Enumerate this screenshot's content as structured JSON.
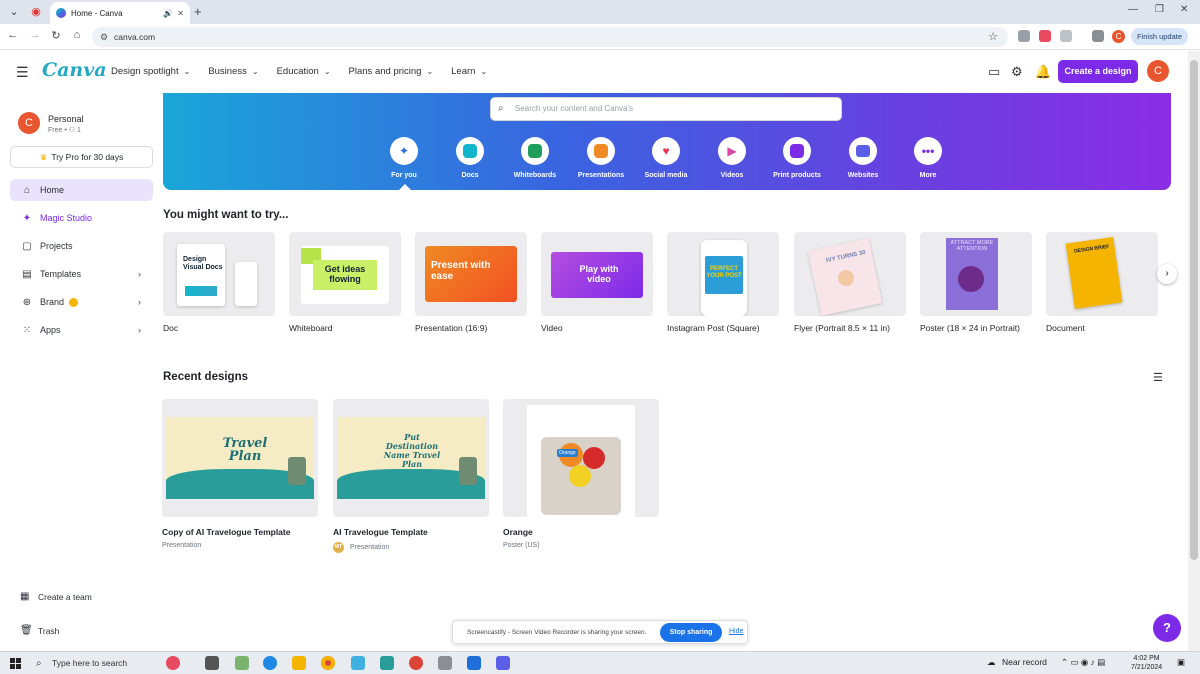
{
  "browser": {
    "tab_title": "Home - Canva",
    "url": "canva.com",
    "finish_update": "Finish update",
    "profile_initial": "C"
  },
  "header": {
    "logo": "Canva",
    "nav": [
      {
        "label": "Design spotlight"
      },
      {
        "label": "Business"
      },
      {
        "label": "Education"
      },
      {
        "label": "Plans and pricing"
      },
      {
        "label": "Learn"
      }
    ],
    "create_button": "Create a design",
    "avatar_initial": "C"
  },
  "sidebar": {
    "account_name": "Personal",
    "account_sub": "Free • ⚇ 1",
    "avatar_initial": "C",
    "try_pro": "Try Pro for 30 days",
    "items": [
      {
        "label": "Home",
        "icon": "home-icon"
      },
      {
        "label": "Magic Studio",
        "icon": "sparkle-icon"
      },
      {
        "label": "Projects",
        "icon": "folder-icon"
      },
      {
        "label": "Templates",
        "icon": "template-icon"
      },
      {
        "label": "Brand",
        "icon": "brand-icon"
      },
      {
        "label": "Apps",
        "icon": "apps-icon"
      }
    ],
    "create_team": "Create a team",
    "trash": "Trash"
  },
  "banner": {
    "search_placeholder": "Search your content and Canva's",
    "categories": [
      {
        "label": "For you",
        "color": "#2f6fe4"
      },
      {
        "label": "Docs",
        "color": "#12b5cb"
      },
      {
        "label": "Whiteboards",
        "color": "#1e9e5a"
      },
      {
        "label": "Presentations",
        "color": "#f08a24"
      },
      {
        "label": "Social media",
        "color": "#e53950"
      },
      {
        "label": "Videos",
        "color": "#d946a8"
      },
      {
        "label": "Print products",
        "color": "#7d2ae8"
      },
      {
        "label": "Websites",
        "color": "#5b5fe8"
      },
      {
        "label": "More",
        "color": "#7d2ae8"
      }
    ]
  },
  "try_section": {
    "heading": "You might want to try...",
    "cards": [
      {
        "label": "Doc",
        "thumb_text": "Design Visual Docs"
      },
      {
        "label": "Whiteboard",
        "thumb_text": "Get ideas flowing"
      },
      {
        "label": "Presentation (16:9)",
        "thumb_text": "Present with ease"
      },
      {
        "label": "Video",
        "thumb_text": "Play with video"
      },
      {
        "label": "Instagram Post (Square)",
        "thumb_text": "PERFECT YOUR POST"
      },
      {
        "label": "Flyer (Portrait 8.5 × 11 in)",
        "thumb_text": "IVY TURNS 30"
      },
      {
        "label": "Poster (18 × 24 in Portrait)",
        "thumb_text": "ATTRACT MORE ATTENTION"
      },
      {
        "label": "Document",
        "thumb_text": "DESIGN BRIEF"
      }
    ]
  },
  "recent_section": {
    "heading": "Recent designs",
    "items": [
      {
        "name": "Copy of AI Travelogue Template",
        "type": "Presentation",
        "thumb_text": "Travel Plan"
      },
      {
        "name": "AI Travelogue Template",
        "type": "Presentation",
        "owner_initials": "MT",
        "thumb_text": "Put Destination Name Travel Plan"
      },
      {
        "name": "Orange",
        "type": "Poster (US)",
        "thumb_text": "Orange"
      }
    ]
  },
  "share_bar": {
    "message": "Screencastify - Screen Video Recorder is sharing your screen.",
    "stop": "Stop sharing",
    "hide": "Hide"
  },
  "taskbar": {
    "search_placeholder": "Type here to search",
    "weather": "Near record",
    "time": "4:02 PM",
    "date": "7/21/2024"
  },
  "help_label": "?"
}
